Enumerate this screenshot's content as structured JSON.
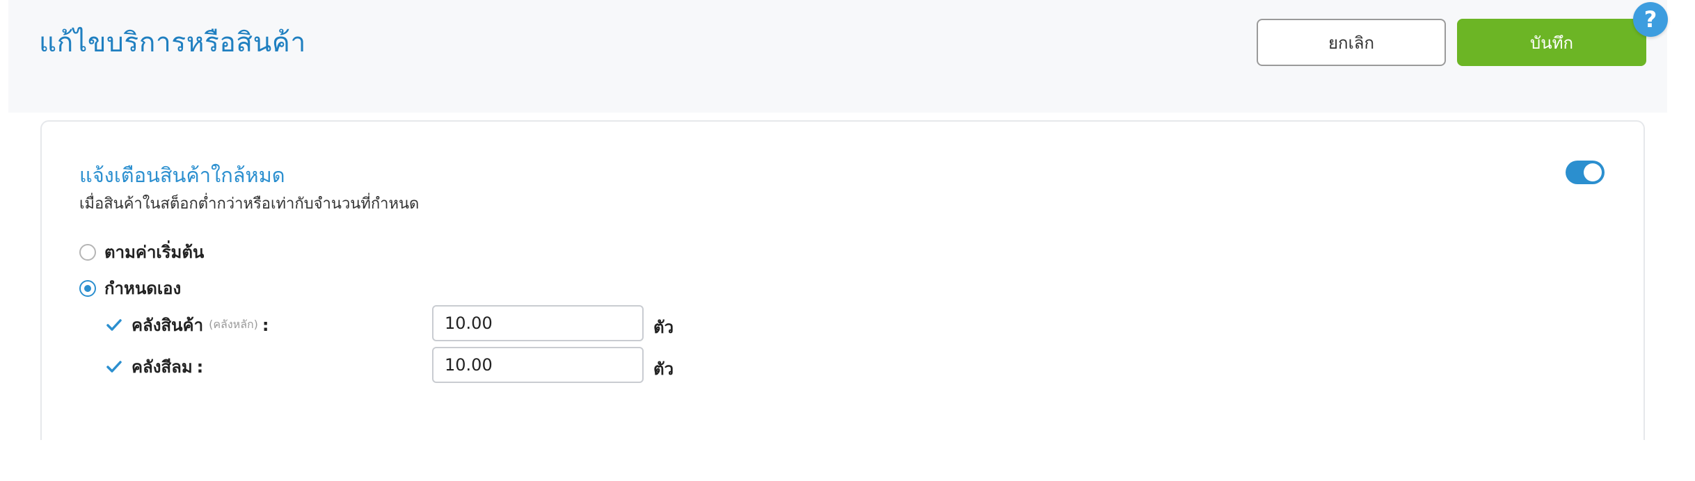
{
  "header": {
    "title": "แก้ไขบริการหรือสินค้า",
    "cancel_label": "ยกเลิก",
    "save_label": "บันทึก",
    "help_label": "?"
  },
  "alert_section": {
    "title": "แจ้งเตือนสินค้าใกล้หมด",
    "description": "เมื่อสินค้าในสต็อกต่ำกว่าหรือเท่ากับจำนวนที่กำหนด",
    "enabled": true,
    "options": [
      {
        "label": "ตามค่าเริ่มต้น",
        "selected": false
      },
      {
        "label": "กำหนดเอง",
        "selected": true
      }
    ],
    "warehouses": [
      {
        "label": "คลังสินค้า",
        "sublabel": "(คลังหลัก)",
        "colon": ":",
        "checked": true,
        "value": "10.00",
        "unit": "ตัว"
      },
      {
        "label": "คลังสีลม",
        "sublabel": "",
        "colon": ":",
        "checked": true,
        "value": "10.00",
        "unit": "ตัว"
      }
    ]
  },
  "colors": {
    "accent": "#2b8fcf",
    "save_button": "#6cb525",
    "help_badge": "#3d9ddf"
  }
}
